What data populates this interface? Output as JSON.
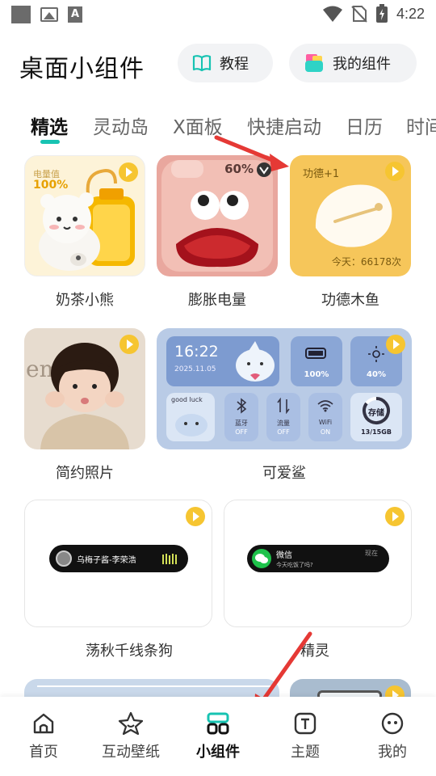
{
  "status_bar": {
    "time": "4:22"
  },
  "header": {
    "title": "桌面小组件",
    "tutorial_label": "教程",
    "my_widgets_label": "我的组件"
  },
  "tabs": [
    "精选",
    "灵动岛",
    "X面板",
    "快捷启动",
    "日历",
    "时间"
  ],
  "widgets": {
    "milk_tea_bear": {
      "label": "奶茶小熊",
      "power_label": "电量值",
      "power_value": "100%"
    },
    "swell_battery": {
      "label": "膨胀电量",
      "percent": "60%"
    },
    "wooden_fish": {
      "label": "功德木鱼",
      "merit": "功德+1",
      "today": "今天：66178次"
    },
    "simple_photo": {
      "label": "简约照片",
      "bg_text": "emb"
    },
    "cute_shark": {
      "label": "可爱鲨",
      "time": "16:22",
      "date": "2025.11.05",
      "battery": "100%",
      "brightness": "40%",
      "good_luck": "good luck",
      "bluetooth_label": "蓝牙",
      "bluetooth_state": "OFF",
      "data_label": "流量",
      "data_state": "OFF",
      "wifi_label": "WiFi",
      "wifi_state": "ON",
      "storage_label": "存储",
      "storage_value": "13/15GB"
    },
    "dog": {
      "label": "荡秋千线条狗",
      "song": "乌梅子酱-李荣浩"
    },
    "sprite": {
      "label": "精灵",
      "app": "微信",
      "tag": "现在",
      "message": "今天吃饭了吗?"
    }
  },
  "bottom_nav": [
    {
      "label": "首页",
      "icon": "home-icon"
    },
    {
      "label": "互动壁纸",
      "icon": "star-face-icon"
    },
    {
      "label": "小组件",
      "icon": "widgets-icon"
    },
    {
      "label": "主题",
      "icon": "theme-icon"
    },
    {
      "label": "我的",
      "icon": "profile-icon"
    }
  ],
  "colors": {
    "accent": "#17c3b2",
    "play": "#f6c531",
    "arrow": "#e53935"
  }
}
